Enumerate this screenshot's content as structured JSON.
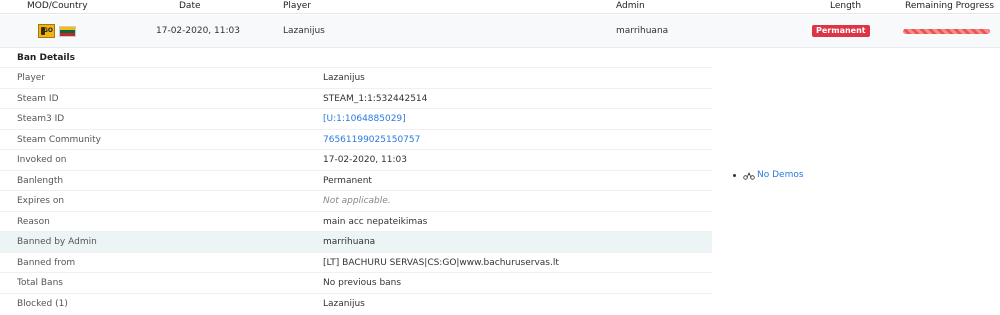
{
  "header": {
    "mod_country": "MOD/Country",
    "date": "Date",
    "player": "Player",
    "admin": "Admin",
    "length": "Length",
    "remaining_progress": "Remaining Progress"
  },
  "summary": {
    "mod_icon_text": "GO",
    "flag_colors": [
      "#FDB913",
      "#006A44",
      "#C1272D"
    ],
    "date": "17-02-2020, 11:03",
    "player": "Lazanijus",
    "admin": "marrihuana",
    "length": "Permanent",
    "progress_percent": 100,
    "badge_color": "#dc3545",
    "progress_color": "#ef5350"
  },
  "details": {
    "title": "Ban Details",
    "rows": [
      {
        "label": "Player",
        "value": "Lazanijus",
        "style": "plain"
      },
      {
        "label": "Steam ID",
        "value": "STEAM_1:1:532442514",
        "style": "plain"
      },
      {
        "label": "Steam3 ID",
        "value": "[U:1:1064885029]",
        "style": "link"
      },
      {
        "label": "Steam Community",
        "value": "76561199025150757",
        "style": "link"
      },
      {
        "label": "Invoked on",
        "value": "17-02-2020, 11:03",
        "style": "plain"
      },
      {
        "label": "Banlength",
        "value": "Permanent",
        "style": "plain"
      },
      {
        "label": "Expires on",
        "value": "Not applicable.",
        "style": "muted"
      },
      {
        "label": "Reason",
        "value": "main acc nepateikimas",
        "style": "plain"
      },
      {
        "label": "Banned by Admin",
        "value": "marrihuana",
        "style": "plain",
        "highlight": true
      },
      {
        "label": "Banned from",
        "value": "[LT] BACHURU SERVAS|CS:GO|www.bachuruservas.lt",
        "style": "plain"
      },
      {
        "label": "Total Bans",
        "value": "No previous bans",
        "style": "plain"
      },
      {
        "label": "Blocked (1)",
        "value": "Lazanijus",
        "style": "plain"
      }
    ]
  },
  "demos": {
    "icon": "demo-icon",
    "label": "No Demos"
  }
}
